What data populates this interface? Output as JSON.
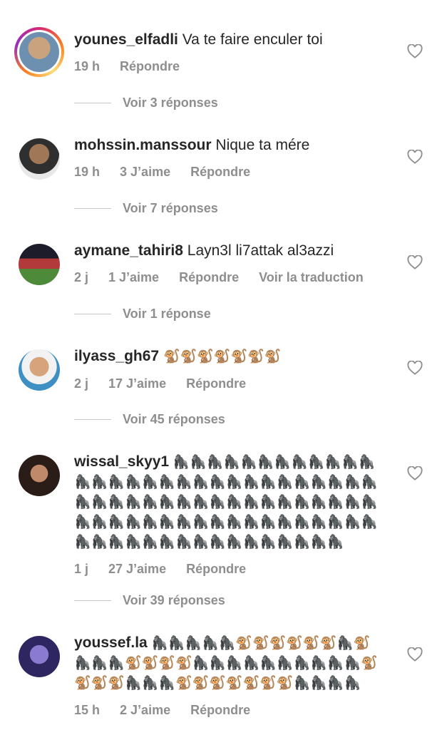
{
  "comments": [
    {
      "username": "younes_elfadli",
      "text": "Va te faire enculer toi",
      "time": "19 h",
      "likes": "",
      "reply": "Répondre",
      "translate": "",
      "view_replies": "Voir 3 réponses",
      "avatar_color": "#b58b6a"
    },
    {
      "username": "mohssin.manssour",
      "text": "Nique ta mére",
      "time": "19 h",
      "likes": "3 J’aime",
      "reply": "Répondre",
      "translate": "",
      "view_replies": "Voir 7 réponses",
      "avatar_color": "#5a5a5a"
    },
    {
      "username": "aymane_tahiri8",
      "text": "Layn3l li7attak al3azzi",
      "time": "2 j",
      "likes": "1 J’aime",
      "reply": "Répondre",
      "translate": "Voir la traduction",
      "view_replies": "Voir 1 réponse",
      "avatar_color": "#7a2b2b"
    },
    {
      "username": "ilyass_gh67",
      "text": "🐒🐒🐒🐒🐒🐒🐒",
      "time": "2 j",
      "likes": "17 J’aime",
      "reply": "Répondre",
      "translate": "",
      "view_replies": "Voir 45 réponses",
      "avatar_color": "#4fa3c9"
    },
    {
      "username": "wissal_skyy1",
      "text": "🦍🦍🦍🦍🦍🦍🦍🦍🦍🦍🦍🦍🦍🦍🦍🦍🦍🦍🦍🦍🦍🦍🦍🦍🦍🦍🦍🦍🦍🦍🦍🦍🦍🦍🦍🦍🦍🦍🦍🦍🦍🦍🦍🦍🦍🦍🦍🦍🦍🦍🦍🦍🦍🦍🦍🦍🦍🦍🦍🦍🦍🦍🦍🦍🦍🦍🦍🦍🦍🦍🦍🦍🦍🦍🦍🦍🦍🦍🦍🦍🦍🦍",
      "time": "1 j",
      "likes": "27 J’aime",
      "reply": "Répondre",
      "translate": "",
      "view_replies": "Voir 39 réponses",
      "avatar_color": "#3b2a22"
    },
    {
      "username": "youssef.la",
      "text": "🦍🦍🦍🦍🦍🐒🐒🐒🐒🐒🐒🦍🐒🦍🦍🦍🐒🐒🐒🐒🦍🦍🦍🦍🦍🦍🦍🦍🦍🦍🐒🐒🐒🐒🦍🦍🦍🐒🐒🐒🐒🐒🐒🐒🦍🦍🦍🦍",
      "time": "15 h",
      "likes": "2 J’aime",
      "reply": "Répondre",
      "translate": "",
      "view_replies": "",
      "avatar_color": "#4a3f8f"
    }
  ]
}
